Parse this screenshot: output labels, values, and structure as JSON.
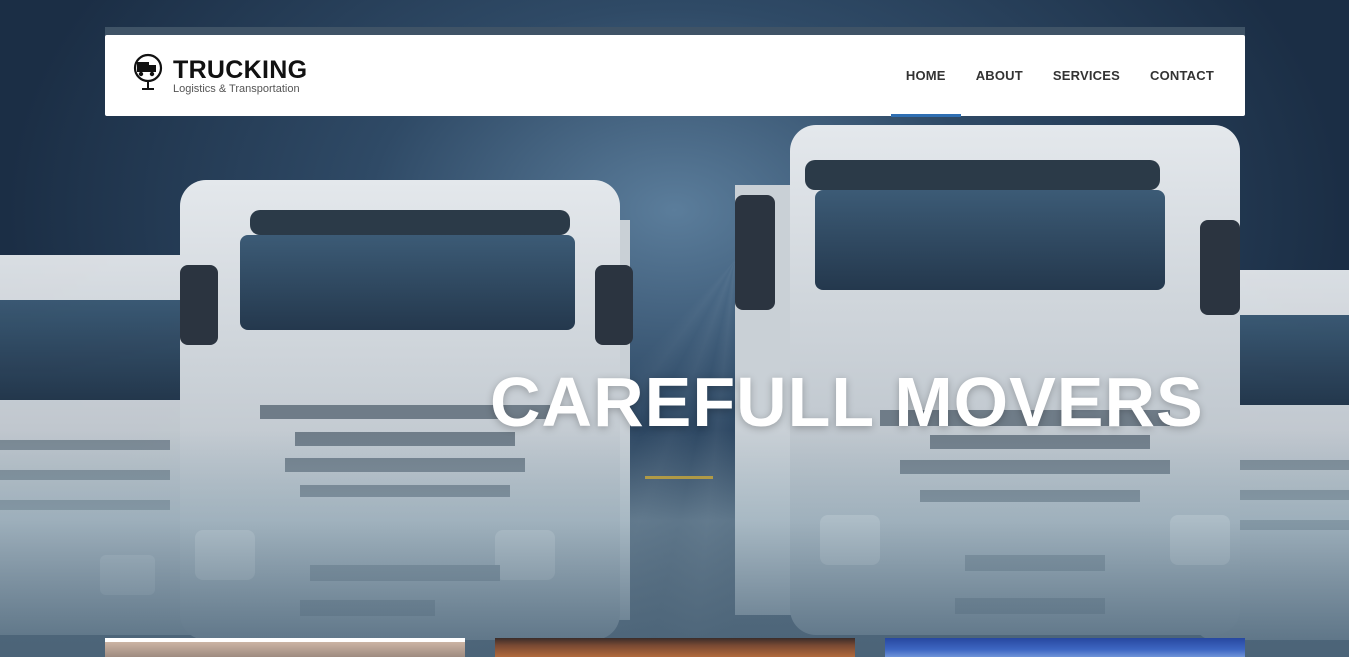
{
  "brand": {
    "name": "TRUCKING",
    "tagline": "Logistics & Transportation",
    "icon": "truck-globe-icon"
  },
  "nav": {
    "items": [
      {
        "label": "HOME",
        "active": true
      },
      {
        "label": "ABOUT",
        "active": false
      },
      {
        "label": "SERVICES",
        "active": false
      },
      {
        "label": "CONTACT",
        "active": false
      }
    ]
  },
  "hero": {
    "title": "CAREFULL MOVERS",
    "background": "white trucks fleet photo",
    "accent_color": "#2f6fb3"
  },
  "cards": [
    {
      "name": "card-landscape"
    },
    {
      "name": "card-sunset"
    },
    {
      "name": "card-sky"
    }
  ]
}
